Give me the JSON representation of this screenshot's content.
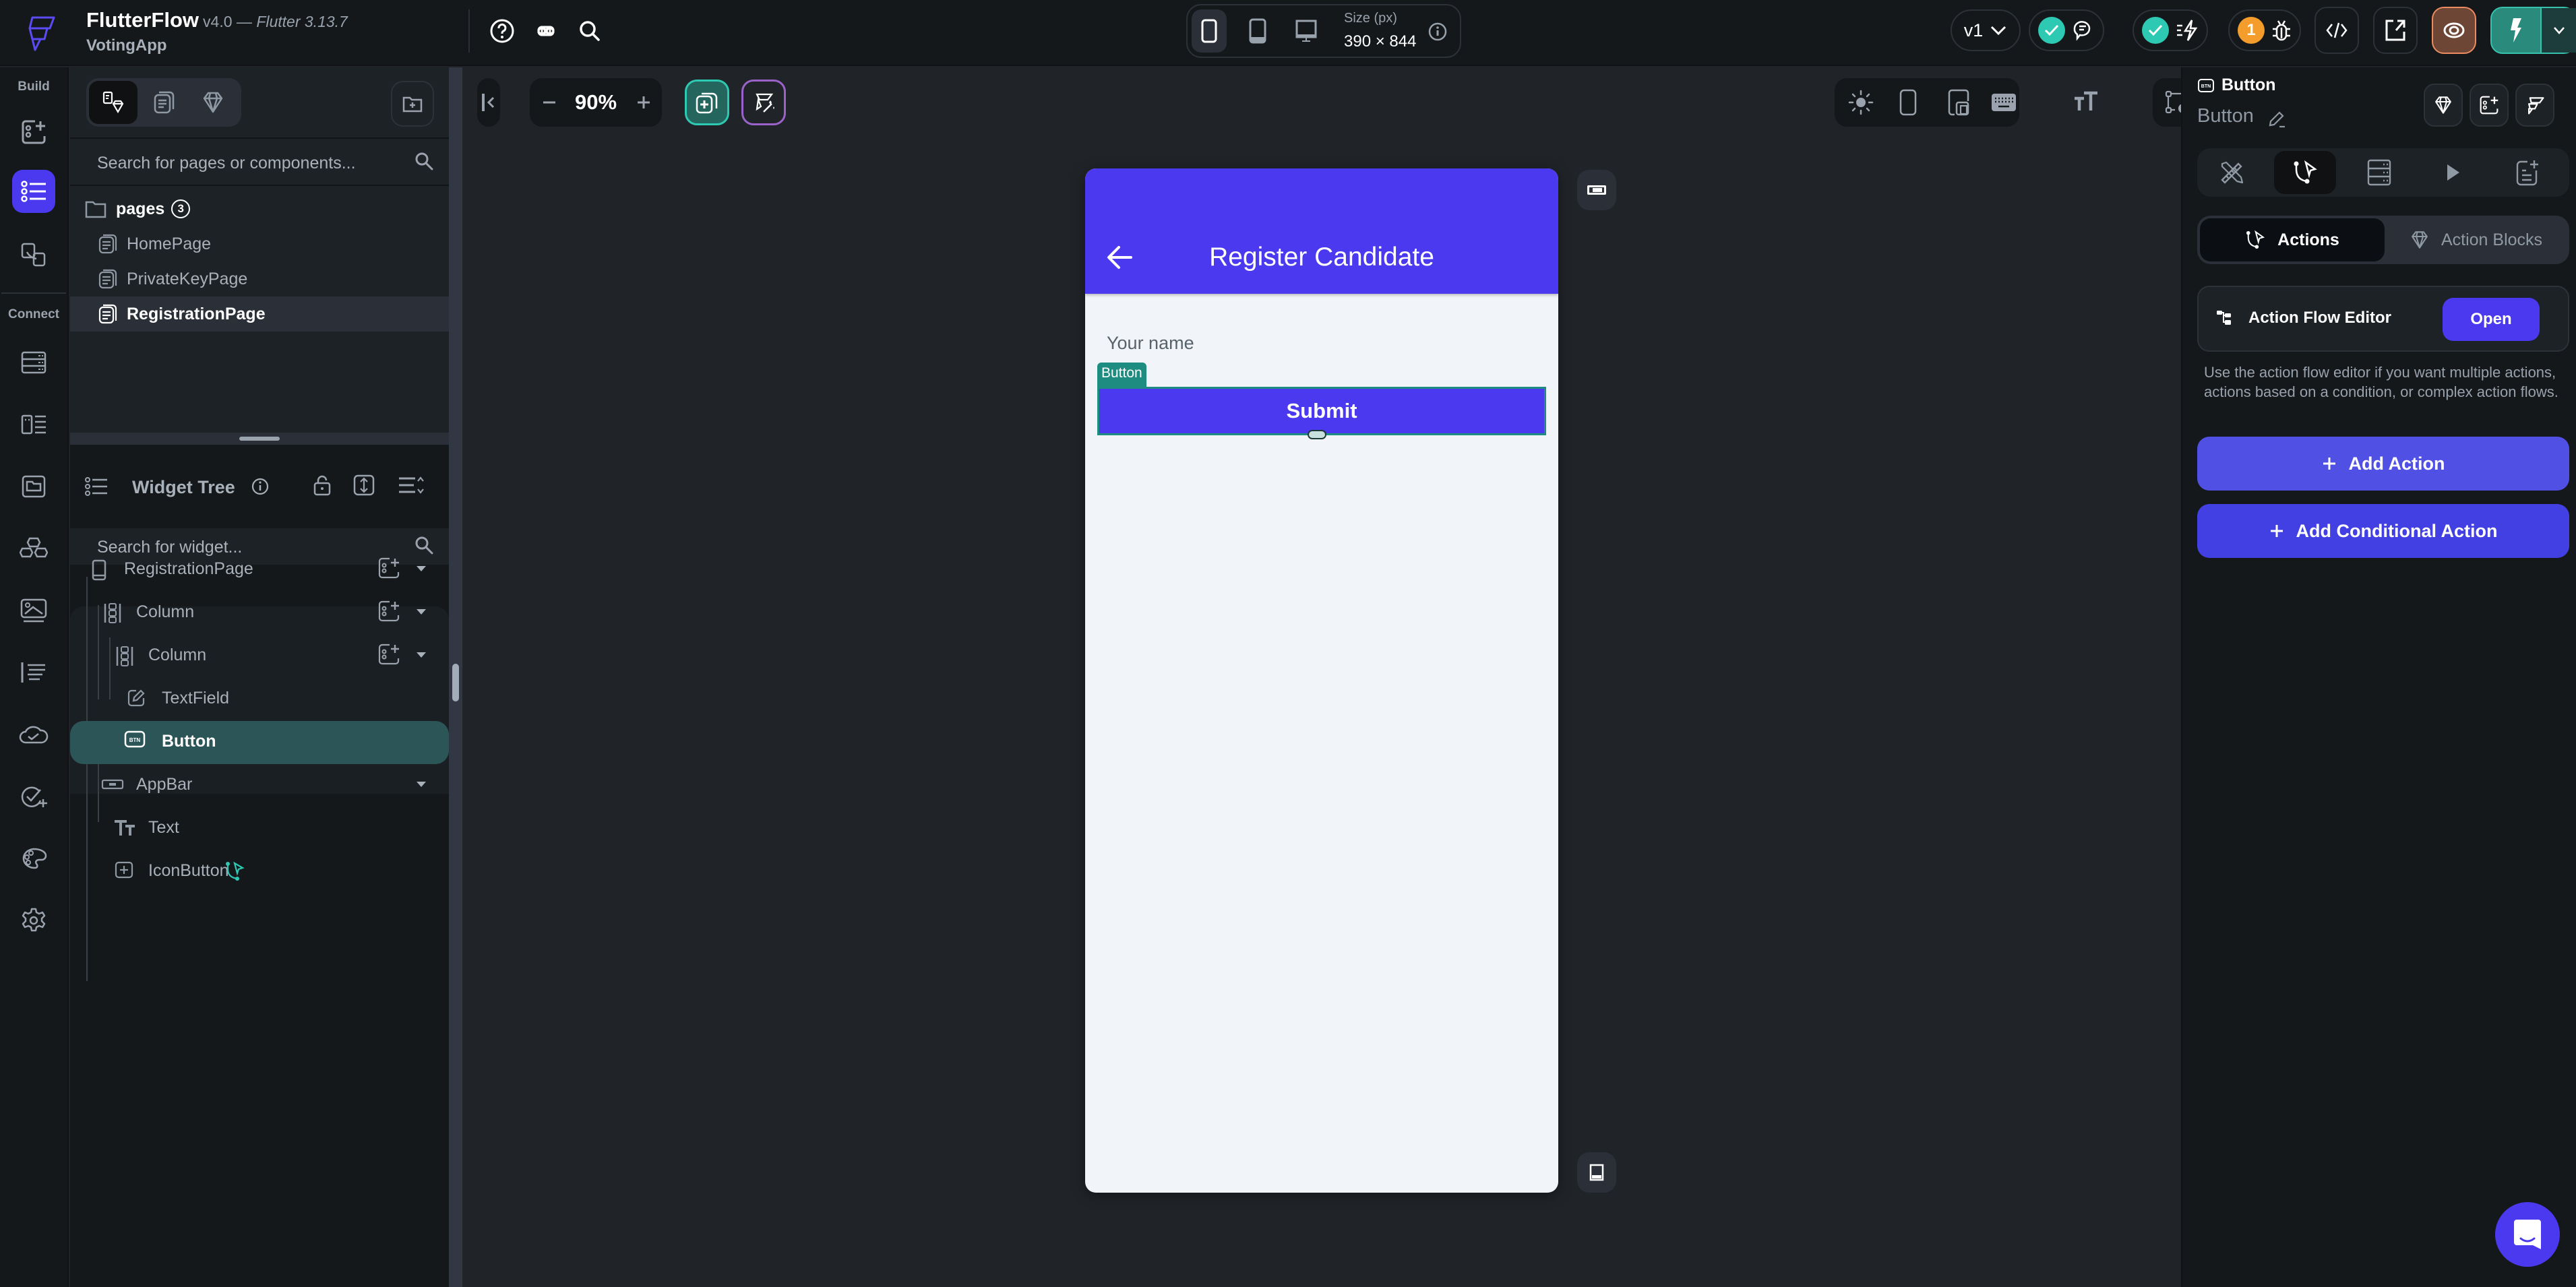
{
  "app": {
    "name": "FlutterFlow",
    "version": "v4.0",
    "version_sep": " — ",
    "flutter_version": "Flutter 3.13.7",
    "project": "VotingApp"
  },
  "topbar": {
    "icons": [
      "help-icon",
      "command-icon",
      "search-icon"
    ],
    "device": {
      "options": [
        "phone",
        "tablet",
        "desktop"
      ],
      "selected": "phone",
      "size_label": "Size (px)",
      "size_value": "390 × 844"
    },
    "version_select": "v1",
    "issues_count": "1"
  },
  "leftnav": {
    "build_label": "Build",
    "connect_label": "Connect",
    "items": [
      {
        "name": "widget-palette",
        "active": false
      },
      {
        "name": "widget-tree",
        "active": true
      },
      {
        "name": "storyboard",
        "active": false
      },
      {
        "name": "data-schema",
        "active": false
      },
      {
        "name": "app-state",
        "active": false
      },
      {
        "name": "media-assets",
        "active": false
      },
      {
        "name": "custom-code",
        "active": false
      },
      {
        "name": "theme-images",
        "active": false
      },
      {
        "name": "api-calls",
        "active": false
      },
      {
        "name": "cloud-functions",
        "active": false
      },
      {
        "name": "tests",
        "active": false
      },
      {
        "name": "theme-settings",
        "active": false
      },
      {
        "name": "settings",
        "active": false
      }
    ]
  },
  "pages_panel": {
    "search_placeholder": "Search for pages or components...",
    "folder": {
      "label": "pages",
      "count": "3"
    },
    "pages": [
      {
        "label": "HomePage",
        "selected": false
      },
      {
        "label": "PrivateKeyPage",
        "selected": false
      },
      {
        "label": "RegistrationPage",
        "selected": true
      }
    ]
  },
  "widget_tree": {
    "title": "Widget Tree",
    "search_placeholder": "Search for widget...",
    "nodes": [
      {
        "label": "RegistrationPage",
        "type": "page"
      },
      {
        "label": "Column",
        "type": "column"
      },
      {
        "label": "Column",
        "type": "column"
      },
      {
        "label": "TextField",
        "type": "textfield"
      },
      {
        "label": "Button",
        "type": "button",
        "selected": true
      },
      {
        "label": "AppBar",
        "type": "appbar"
      },
      {
        "label": "Text",
        "type": "text"
      },
      {
        "label": "IconButton",
        "type": "iconbutton",
        "has_action": true
      }
    ]
  },
  "canvas": {
    "zoom": "90%",
    "appbar_title": "Register Candidate",
    "textfield_hint": "Your name",
    "selected_tag": "Button",
    "button_label": "Submit",
    "colors": {
      "primary": "#4b39ef",
      "selection": "#1f8c81",
      "background": "#f1f4f8"
    }
  },
  "properties": {
    "widget_type": "Button",
    "widget_name": "Button",
    "tabs": [
      "properties",
      "actions",
      "backend-query",
      "animations",
      "documentation"
    ],
    "active_tab": "actions",
    "action_tabs": [
      {
        "label": "Actions",
        "active": true
      },
      {
        "label": "Action Blocks",
        "active": false
      }
    ],
    "action_flow_editor": {
      "label": "Action Flow Editor",
      "open_label": "Open",
      "description": "Use the action flow editor if you want multiple actions, actions based on a condition, or complex action flows."
    },
    "add_action": "Add Action",
    "add_conditional_action": "Add Conditional Action"
  }
}
